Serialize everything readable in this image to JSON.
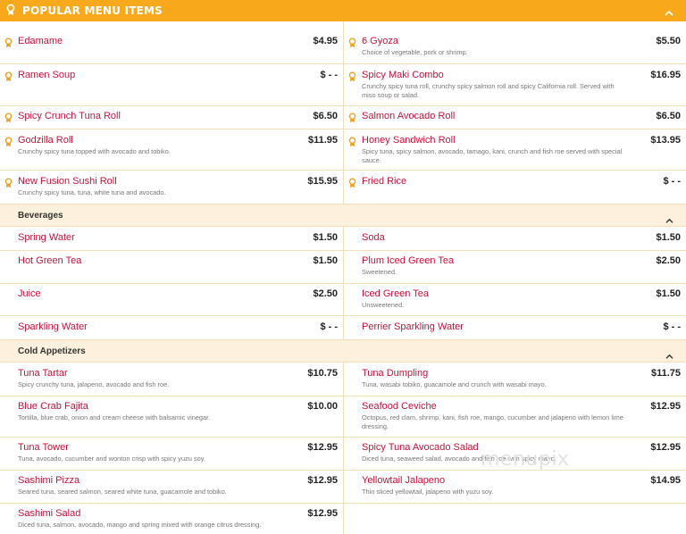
{
  "header": {
    "title": "POPULAR MENU ITEMS"
  },
  "popular": [
    {
      "name": "Edamame",
      "price": "$4.95",
      "desc": ""
    },
    {
      "name": "6 Gyoza",
      "price": "$5.50",
      "desc": "Choice of vegetable, pork or shrimp."
    },
    {
      "name": "Ramen Soup",
      "price": "$ - -",
      "desc": ""
    },
    {
      "name": "Spicy Maki Combo",
      "price": "$16.95",
      "desc": "Crunchy spicy tuna roll, crunchy spicy salmon roll and spicy California roll. Served with miso soup or salad."
    },
    {
      "name": "Spicy Crunch Tuna Roll",
      "price": "$6.50",
      "desc": ""
    },
    {
      "name": "Salmon Avocado Roll",
      "price": "$6.50",
      "desc": ""
    },
    {
      "name": "Godzilla Roll",
      "price": "$11.95",
      "desc": "Crunchy spicy tuna topped with avocado and tobiko."
    },
    {
      "name": "Honey Sandwich Roll",
      "price": "$13.95",
      "desc": "Spicy tuna, spicy salmon, avocado, tamago, kani, crunch and fish roe served with special sauce."
    },
    {
      "name": "New Fusion Sushi Roll",
      "price": "$15.95",
      "desc": "Crunchy spicy tuna, tuna, white tuna and avocado."
    },
    {
      "name": "Fried Rice",
      "price": "$ - -",
      "desc": ""
    }
  ],
  "beverages": {
    "title": "Beverages",
    "items": [
      {
        "name": "Spring Water",
        "price": "$1.50",
        "desc": ""
      },
      {
        "name": "Soda",
        "price": "$1.50",
        "desc": ""
      },
      {
        "name": "Hot Green Tea",
        "price": "$1.50",
        "desc": ""
      },
      {
        "name": "Plum Iced Green Tea",
        "price": "$2.50",
        "desc": "Sweetened."
      },
      {
        "name": "Juice",
        "price": "$2.50",
        "desc": ""
      },
      {
        "name": "Iced Green Tea",
        "price": "$1.50",
        "desc": "Unsweetened."
      },
      {
        "name": "Sparkling Water",
        "price": "$ - -",
        "desc": ""
      },
      {
        "name": "Perrier Sparkling Water",
        "price": "$ - -",
        "desc": ""
      }
    ]
  },
  "cold": {
    "title": "Cold Appetizers",
    "items": [
      {
        "name": "Tuna Tartar",
        "price": "$10.75",
        "desc": "Spicy crunchy tuna, jalapeno, avocado and fish roe."
      },
      {
        "name": "Tuna Dumpling",
        "price": "$11.75",
        "desc": "Tuna, wasabi tobiko, guacamole and crunch with wasabi mayo."
      },
      {
        "name": "Blue Crab Fajita",
        "price": "$10.00",
        "desc": "Tortilla, blue crab, onion and cream cheese with balsamic vinegar."
      },
      {
        "name": "Seafood Ceviche",
        "price": "$12.95",
        "desc": "Octopus, red clam, shrimp, kani, fish roe, mango, cucumber and jalapeno with lemon lime dressing."
      },
      {
        "name": "Tuna Tower",
        "price": "$12.95",
        "desc": "Tuna, avocado, cucumber and wonton crisp with spicy yuzu soy."
      },
      {
        "name": "Spicy Tuna Avocado Salad",
        "price": "$12.95",
        "desc": "Diced tuna, seaweed salad, avocado and fish roe with spicy mayo."
      },
      {
        "name": "Sashimi Pizza",
        "price": "$12.95",
        "desc": "Seared tuna, seared salmon, seared white tuna, guacamole and tobiko."
      },
      {
        "name": "Yellowtail Jalapeno",
        "price": "$14.95",
        "desc": "Thin sliced yellowtail, jalapeno with yuzu soy."
      },
      {
        "name": "Sashimi Salad",
        "price": "$12.95",
        "desc": "Diced tuna, salmon, avocado, mango and spring mixed with orange citrus dressing."
      }
    ]
  },
  "watermark": "menupix",
  "colors": {
    "accent": "#f7a81b",
    "item_name": "#c5123b",
    "section_bg": "#fdf0dc"
  }
}
